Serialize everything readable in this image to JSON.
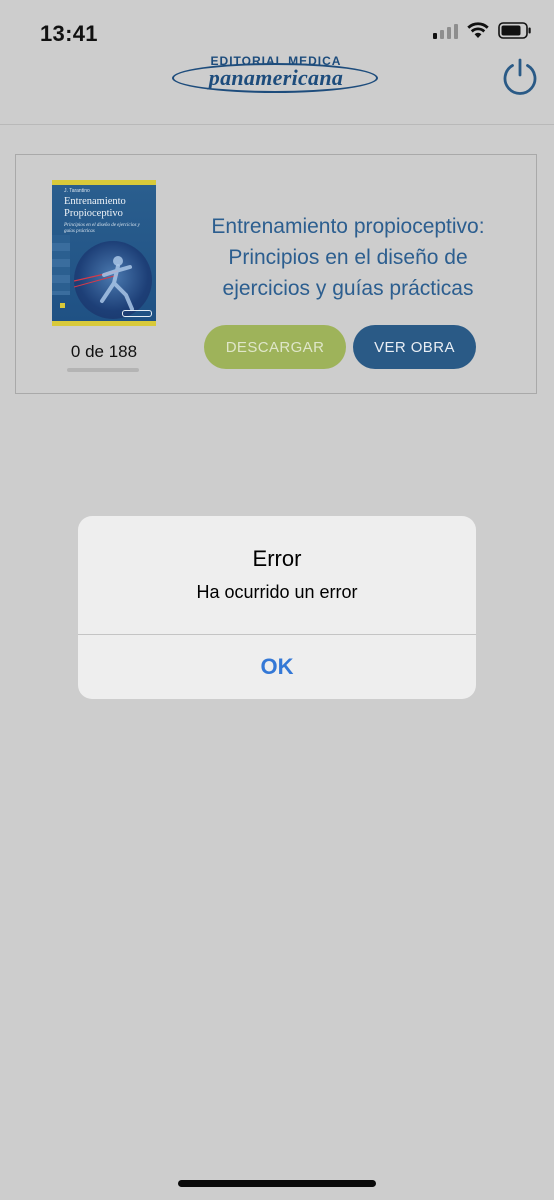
{
  "status_bar": {
    "time": "13:41",
    "signal_icon": "cellular-signal-icon",
    "wifi_icon": "wifi-icon",
    "battery_icon": "battery-icon"
  },
  "header": {
    "logo_top": "EDITORIAL MEDICA",
    "logo_main": "panamericana",
    "power_icon": "power-icon"
  },
  "book": {
    "cover": {
      "author": "J. Tarantino",
      "title": "Entrenamiento Propioceptivo",
      "subtitle": "Principios en el diseño de ejercicios y guías prácticas"
    },
    "title": "Entrenamiento propioceptivo: Principios en el diseño de ejercicios y guías prácticas",
    "progress_text": "0 de 188",
    "progress_fraction": 0,
    "download_label": "DESCARGAR",
    "view_label": "VER OBRA"
  },
  "alert": {
    "title": "Error",
    "message": "Ha ocurrido un error",
    "ok_label": "OK"
  },
  "colors": {
    "background": "#cdcdcd",
    "brand_blue": "#1d4c7c",
    "download_green": "#9eb35a",
    "view_blue": "#2a5a86",
    "ios_link_blue": "#3478d6"
  }
}
